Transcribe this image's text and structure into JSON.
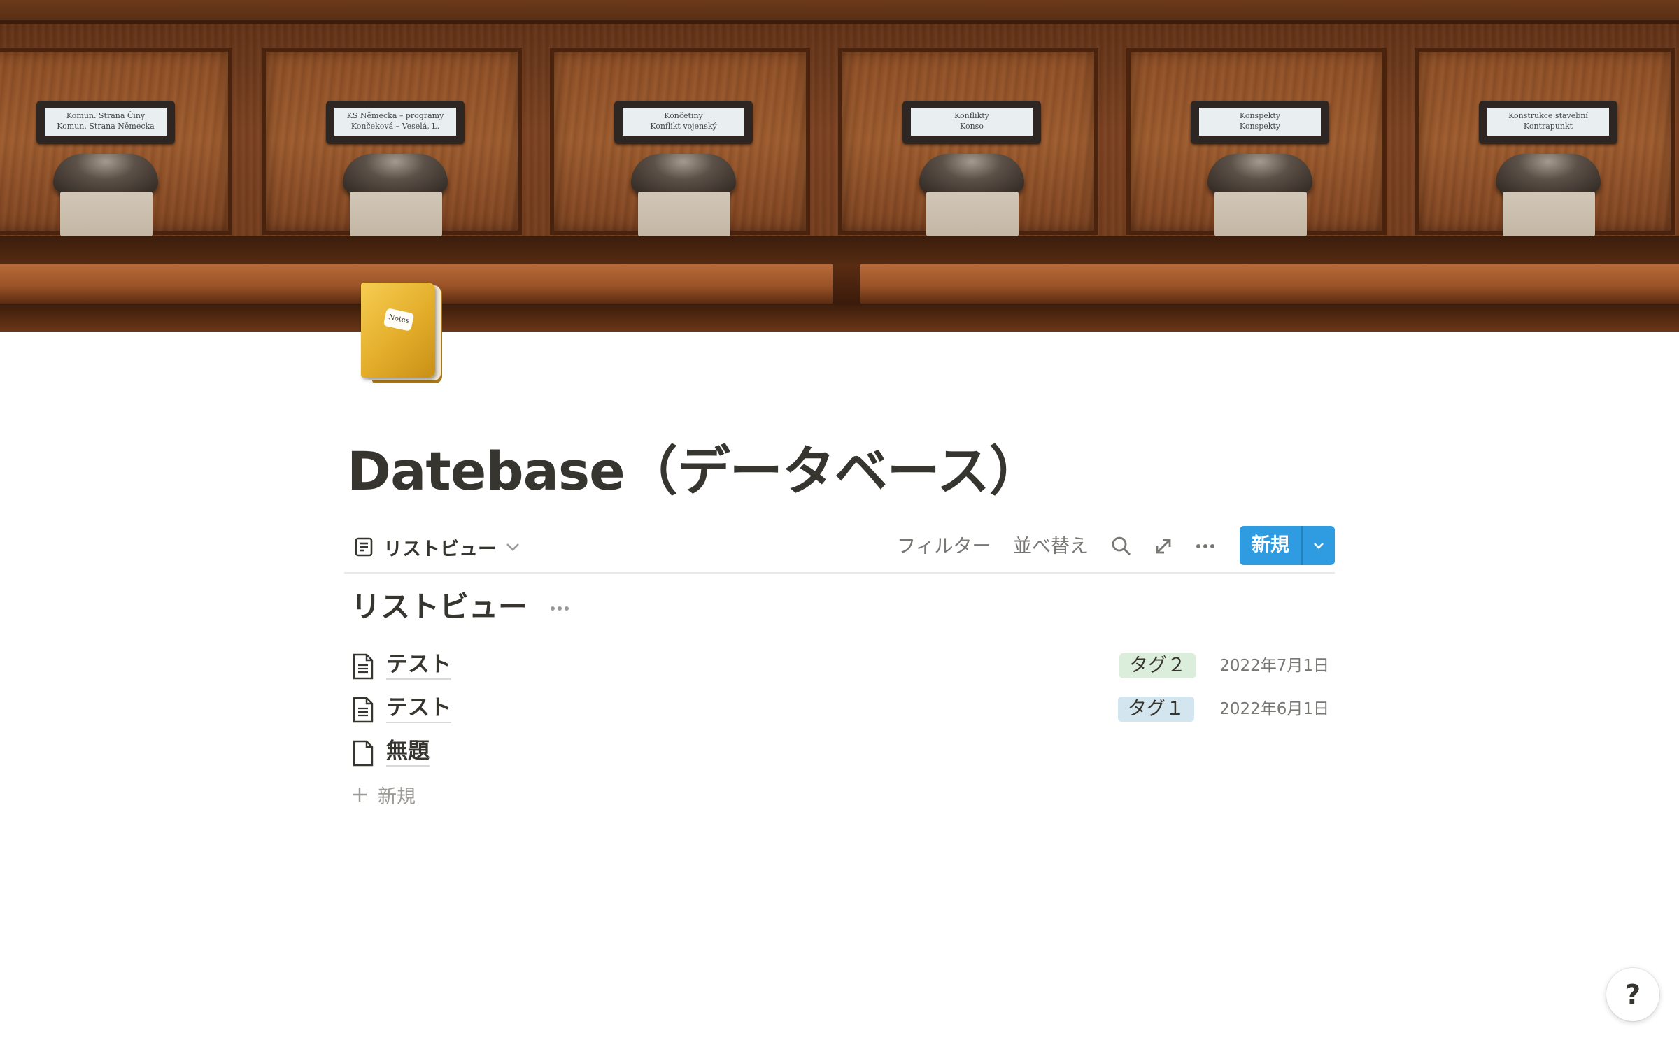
{
  "cover": {
    "drawer_labels": [
      [
        "Komun. Strana Činy",
        "Komun. Strana Německa"
      ],
      [
        "KS Německa – programy",
        "Končeková – Veselá, L."
      ],
      [
        "Končetiny",
        "Konflikt vojenský"
      ],
      [
        "Konflikty",
        "Konso"
      ],
      [
        "Konspekty",
        "Konspekty"
      ],
      [
        "Konstrukce stavební",
        "Kontrapunkt"
      ]
    ]
  },
  "page_icon": {
    "name": "notebook-icon",
    "label": "Notes"
  },
  "page": {
    "title": "Datebase（データベース）"
  },
  "toolbar": {
    "view_name": "リストビュー",
    "filter": "フィルター",
    "sort": "並べ替え",
    "new": "新規"
  },
  "list": {
    "title": "リストビュー",
    "rows": [
      {
        "title": "テスト",
        "tag": "タグ２",
        "tag_color": "#dbeddb",
        "date": "2022年7月1日"
      },
      {
        "title": "テスト",
        "tag": "タグ１",
        "tag_color": "#d3e5ef",
        "date": "2022年6月1日"
      },
      {
        "title": "無題",
        "tag": "",
        "tag_color": "",
        "date": ""
      }
    ],
    "add_label": "新規"
  },
  "help": {
    "label": "?"
  },
  "colors": {
    "accent": "#2f9be0",
    "text": "#37352f",
    "muted": "#787774"
  }
}
